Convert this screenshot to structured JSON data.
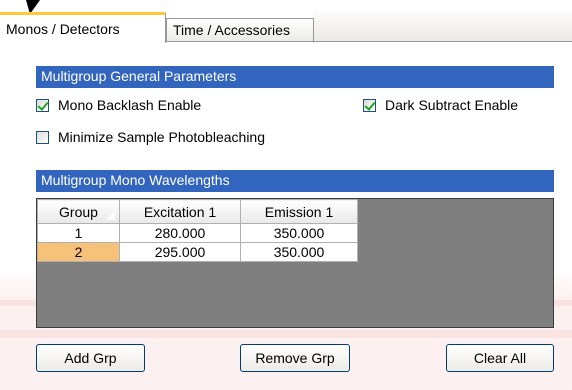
{
  "tabs": [
    {
      "label": "Monos / Detectors",
      "active": true
    },
    {
      "label": "Time / Accessories",
      "active": false
    }
  ],
  "general": {
    "header": "Multigroup General Parameters",
    "mono_backlash": {
      "label": "Mono Backlash Enable",
      "checked": true
    },
    "dark_subtract": {
      "label": "Dark Subtract Enable",
      "checked": true
    },
    "photobleaching": {
      "label": "Minimize Sample Photobleaching",
      "checked": false
    }
  },
  "wavelengths": {
    "header": "Multigroup Mono Wavelengths",
    "columns": [
      "Group",
      "Excitation 1",
      "Emission 1"
    ],
    "rows": [
      {
        "group": "1",
        "excitation": "280.000",
        "emission": "350.000",
        "selected": false
      },
      {
        "group": "2",
        "excitation": "295.000",
        "emission": "350.000",
        "selected": true
      }
    ]
  },
  "buttons": {
    "add": "Add Grp",
    "remove": "Remove Grp",
    "clear": "Clear All"
  },
  "colors": {
    "header_bar": "#3265be",
    "selected_row": "#f6c27a",
    "active_tab_accent": "#ffc83c"
  }
}
